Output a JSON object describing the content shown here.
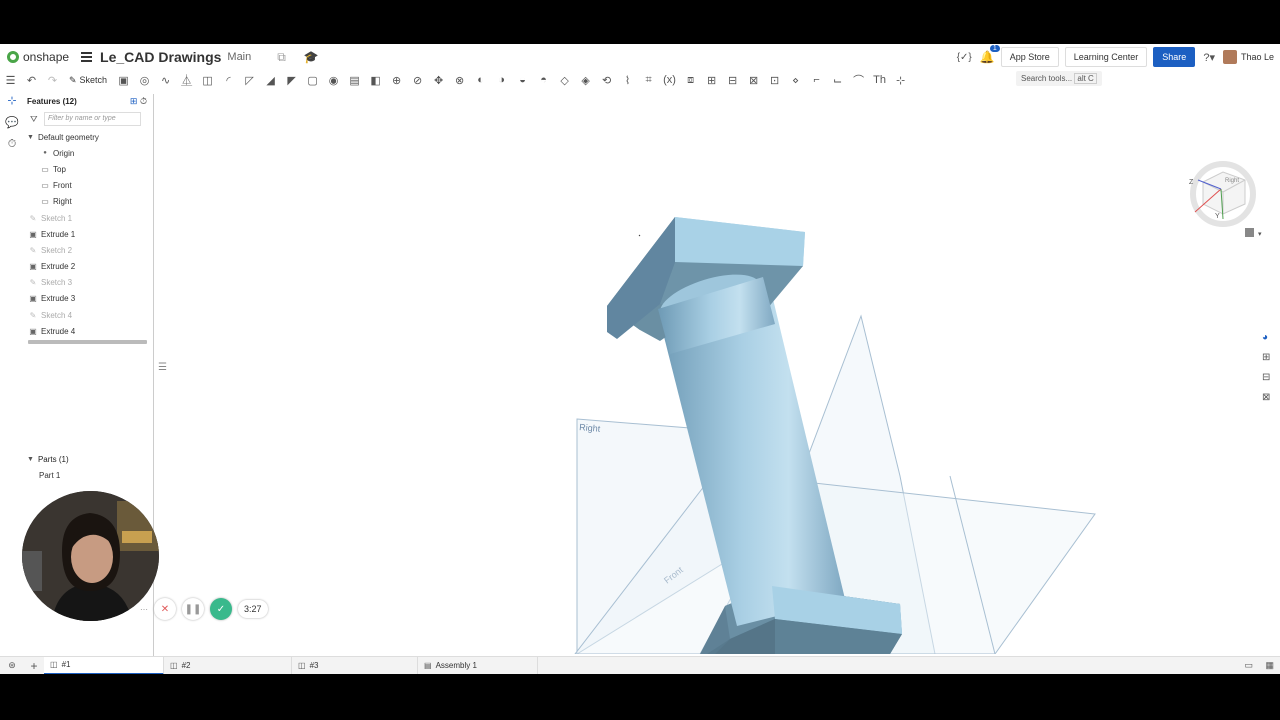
{
  "app": {
    "logo_text": "onshape",
    "doc_title": "Le_CAD Drawings",
    "branch": "Main"
  },
  "header": {
    "app_store": "App Store",
    "learning_center": "Learning Center",
    "share": "Share",
    "user_name": "Thao Le",
    "notification_count": "1",
    "brand_color": "#1c5fc2"
  },
  "toolbar": {
    "sketch_label": "Sketch",
    "search_placeholder": "Search tools...",
    "search_shortcut": "alt C"
  },
  "features": {
    "title": "Features (12)",
    "filter_placeholder": "Filter by name or type",
    "default_geometry": "Default geometry",
    "items": [
      {
        "label": "Origin",
        "kind": "origin"
      },
      {
        "label": "Top",
        "kind": "plane"
      },
      {
        "label": "Front",
        "kind": "plane"
      },
      {
        "label": "Right",
        "kind": "plane"
      },
      {
        "label": "Sketch 1",
        "kind": "sketch"
      },
      {
        "label": "Extrude 1",
        "kind": "extrude"
      },
      {
        "label": "Sketch 2",
        "kind": "sketch"
      },
      {
        "label": "Extrude 2",
        "kind": "extrude"
      },
      {
        "label": "Sketch 3",
        "kind": "sketch"
      },
      {
        "label": "Extrude 3",
        "kind": "extrude"
      },
      {
        "label": "Sketch 4",
        "kind": "sketch"
      },
      {
        "label": "Extrude 4",
        "kind": "extrude"
      }
    ]
  },
  "parts": {
    "title": "Parts (1)",
    "items": [
      "Part 1"
    ]
  },
  "recorder": {
    "time": "3:27"
  },
  "viewport": {
    "plane_right": "Right",
    "plane_front": "Front"
  },
  "tabs": [
    {
      "label": "#1"
    },
    {
      "label": "#2"
    },
    {
      "label": "#3"
    },
    {
      "label": "Assembly 1"
    }
  ]
}
